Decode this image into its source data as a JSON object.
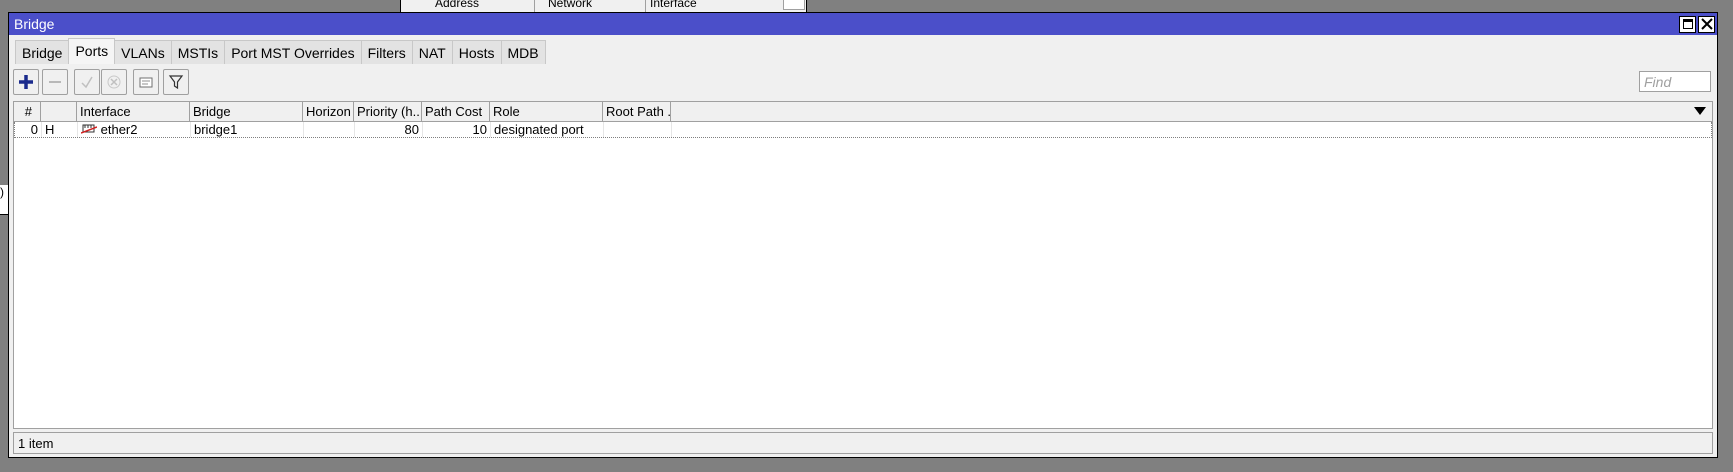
{
  "background": {
    "columns": [
      "Address",
      "Network",
      "Interface"
    ],
    "left_fragment": ") i"
  },
  "window": {
    "title": "Bridge"
  },
  "tabs": [
    "Bridge",
    "Ports",
    "VLANs",
    "MSTIs",
    "Port MST Overrides",
    "Filters",
    "NAT",
    "Hosts",
    "MDB"
  ],
  "active_tab": "Ports",
  "toolbar": {
    "add": "+",
    "find_placeholder": "Find"
  },
  "table": {
    "columns": [
      "#",
      "",
      "Interface",
      "Bridge",
      "Horizon",
      "Priority (h...",
      "Path Cost",
      "Role",
      "Root Path ..."
    ],
    "rows": [
      {
        "index": "0",
        "flag": "H",
        "interface": "ether2",
        "bridge": "bridge1",
        "horizon": "",
        "priority": "80",
        "path_cost": "10",
        "role": "designated port",
        "root_path": ""
      }
    ]
  },
  "status": {
    "text": "1 item"
  },
  "colors": {
    "titlebar": "#4b4fc9",
    "add_icon": "#1a2a8c"
  },
  "icons": {
    "add": "plus-icon",
    "remove": "minus-icon",
    "enable": "check-icon",
    "disable": "x-icon",
    "comment": "note-icon",
    "filter": "filter-icon",
    "interface": "ethernet-icon"
  }
}
